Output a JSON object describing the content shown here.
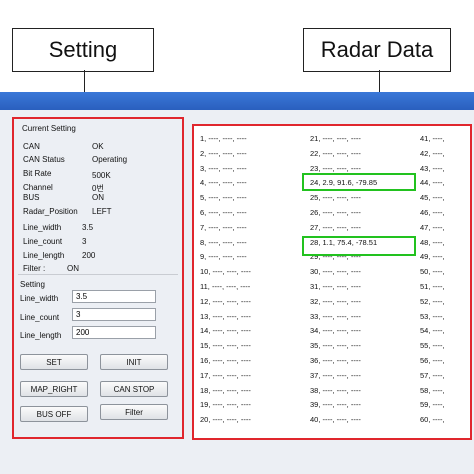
{
  "callouts": {
    "setting": "Setting",
    "radar": "Radar Data"
  },
  "current_setting": {
    "title": "Current Setting",
    "rows": [
      {
        "label": "CAN",
        "value": "OK"
      },
      {
        "label": "CAN Status",
        "value": "Operating"
      },
      {
        "label": "Bit Rate",
        "value": "500K"
      },
      {
        "label": "Channel",
        "value": "0번"
      },
      {
        "label": "BUS",
        "value": "ON"
      },
      {
        "label": "Radar_Position",
        "value": "LEFT"
      },
      {
        "label": "Line_width",
        "value": "3.5"
      },
      {
        "label": "Line_count",
        "value": "3"
      },
      {
        "label": "Line_length",
        "value": "200"
      },
      {
        "label": "Filter :",
        "value": "ON"
      }
    ]
  },
  "setting": {
    "title": "Setting",
    "fields": [
      {
        "label": "Line_width",
        "value": "3.5"
      },
      {
        "label": "Line_count",
        "value": "3"
      },
      {
        "label": "Line_length",
        "value": "200"
      }
    ]
  },
  "buttons": {
    "set": "SET",
    "init": "INIT",
    "map_right": "MAP_RIGHT",
    "can_stop": "CAN STOP",
    "bus_off": "BUS OFF",
    "filter": "Filter"
  },
  "radar": {
    "col1": [
      "1,  ----,  ----,  ----",
      "2,  ----,  ----,  ----",
      "3,  ----,  ----,  ----",
      "4,  ----,  ----,  ----",
      "5,  ----,  ----,  ----",
      "6,  ----,  ----,  ----",
      "7,  ----,  ----,  ----",
      "8,  ----,  ----,  ----",
      "9,  ----,  ----,  ----",
      "10,  ----,  ----,  ----",
      "11,  ----,  ----,  ----",
      "12,  ----,  ----,  ----",
      "13,  ----,  ----,  ----",
      "14,  ----,  ----,  ----",
      "15,  ----,  ----,  ----",
      "16,  ----,  ----,  ----",
      "17,  ----,  ----,  ----",
      "18,  ----,  ----,  ----",
      "19,  ----,  ----,  ----",
      "20,  ----,  ----,  ----"
    ],
    "col2": [
      "21,  ----,  ----,  ----",
      "22,  ----,  ----,  ----",
      "23,  ----,  ----,  ----",
      "24,  2.9,  91.6,  -79.85",
      "25,  ----,  ----,  ----",
      "26,  ----,  ----,  ----",
      "27,  ----,  ----,  ----",
      "28,  1.1,  75.4,  -78.51",
      "29,  ----,  ----,  ----",
      "30,  ----,  ----,  ----",
      "31,  ----,  ----,  ----",
      "32,  ----,  ----,  ----",
      "33,  ----,  ----,  ----",
      "34,  ----,  ----,  ----",
      "35,  ----,  ----,  ----",
      "36,  ----,  ----,  ----",
      "37,  ----,  ----,  ----",
      "38,  ----,  ----,  ----",
      "39,  ----,  ----,  ----",
      "40,  ----,  ----,  ----"
    ],
    "col3": [
      "41,  ----,",
      "42,  ----,",
      "43,  ----,",
      "44,  ----,",
      "45,  ----,",
      "46,  ----,",
      "47,  ----,",
      "48,  ----,",
      "49,  ----,",
      "50,  ----,",
      "51,  ----,",
      "52,  ----,",
      "53,  ----,",
      "54,  ----,",
      "55,  ----,",
      "56,  ----,",
      "57,  ----,",
      "58,  ----,",
      "59,  ----,",
      "60,  ----,"
    ]
  },
  "colors": {
    "panel_border": "#e0262d",
    "highlight": "#22c21f",
    "titlebar": "#2a5fbe"
  }
}
